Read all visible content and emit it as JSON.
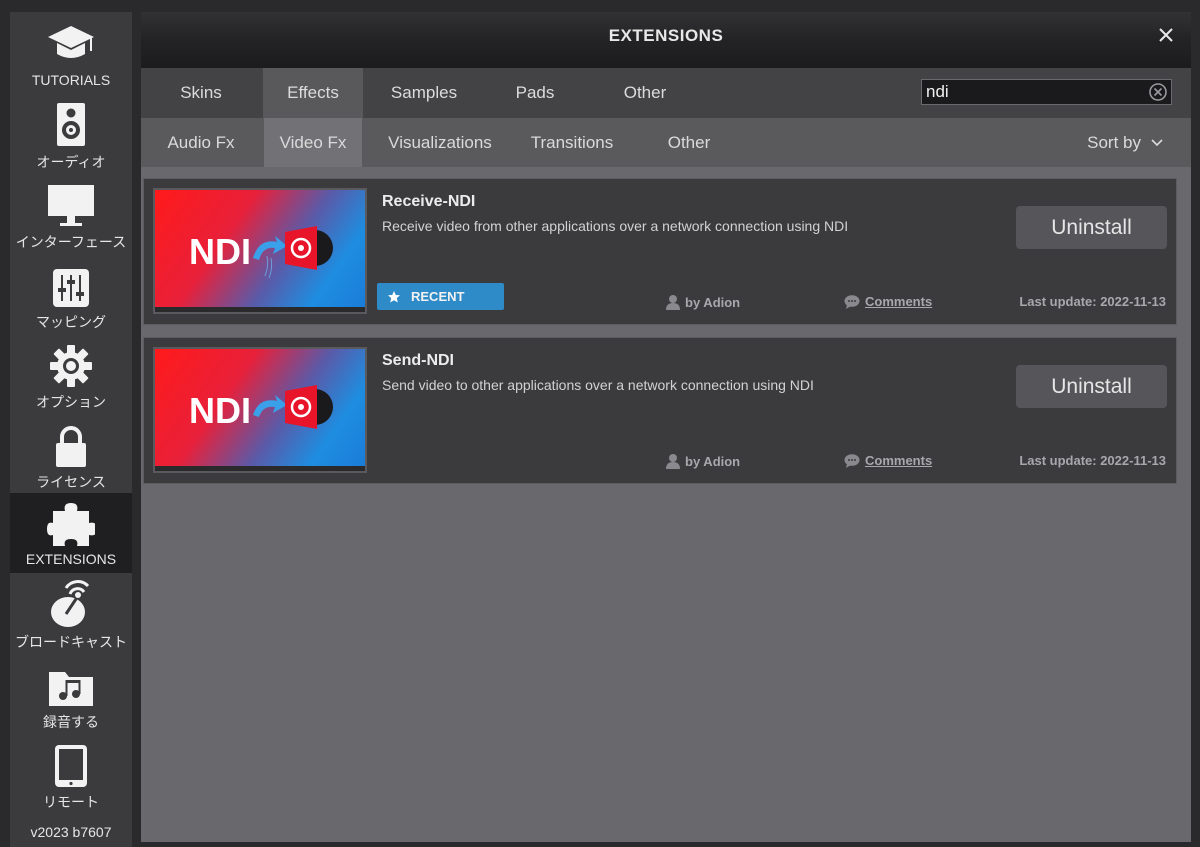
{
  "sidebar": {
    "items": [
      {
        "label": "TUTORIALS",
        "icon": "graduation-cap-icon"
      },
      {
        "label": "オーディオ",
        "icon": "speaker-icon"
      },
      {
        "label": "インターフェース",
        "icon": "monitor-icon"
      },
      {
        "label": "マッピング",
        "icon": "mixer-sliders-icon"
      },
      {
        "label": "オプション",
        "icon": "gear-icon"
      },
      {
        "label": "ライセンス",
        "icon": "lock-icon"
      },
      {
        "label": "EXTENSIONS",
        "icon": "puzzle-icon",
        "active": true
      },
      {
        "label": "ブロードキャスト",
        "icon": "satellite-dish-icon"
      },
      {
        "label": "録音する",
        "icon": "music-folder-icon"
      },
      {
        "label": "リモート",
        "icon": "tablet-icon"
      }
    ],
    "version": "v2023 b7607"
  },
  "window": {
    "title": "EXTENSIONS",
    "close_icon": "close-icon"
  },
  "category_tabs": [
    "Skins",
    "Effects",
    "Samples",
    "Pads",
    "Other"
  ],
  "active_category": "Effects",
  "search": {
    "value": "ndi",
    "clear_icon": "clear-search-icon"
  },
  "sub_tabs": [
    "Audio Fx",
    "Video Fx",
    "Visualizations",
    "Transitions",
    "Other"
  ],
  "active_sub_tab": "Video Fx",
  "sort_label": "Sort by",
  "extensions": [
    {
      "name": "Receive-NDI",
      "description": "Receive video from other applications over a network connection using NDI",
      "thumbnail_text": "NDI",
      "action": "Uninstall",
      "badge": "RECENT",
      "author": "by Adion",
      "comments": "Comments",
      "last_update": "Last update: 2022-11-13"
    },
    {
      "name": "Send-NDI",
      "description": "Send video to other applications over a network connection using NDI",
      "thumbnail_text": "NDI",
      "action": "Uninstall",
      "author": "by Adion",
      "comments": "Comments",
      "last_update": "Last update: 2022-11-13"
    }
  ],
  "colors": {
    "accent_badge": "#2e8bc8",
    "thumbnail_red": "#ff1a1a",
    "thumbnail_blue": "#1a7bd8"
  }
}
